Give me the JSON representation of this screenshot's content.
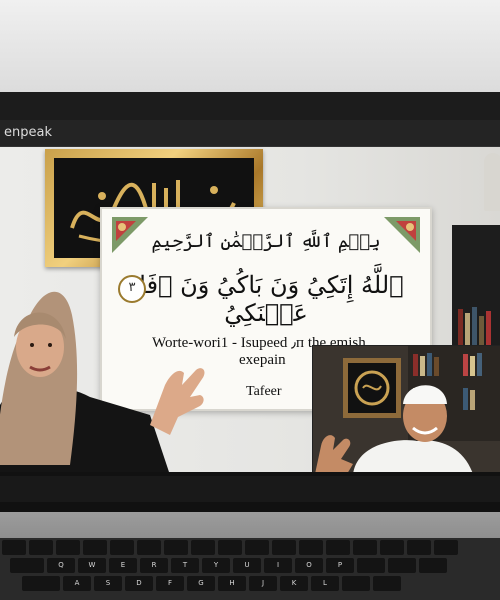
{
  "app": {
    "title": "enpeak"
  },
  "lesson": {
    "basmala": "بِسۡمِ ٱللَّهِ ٱلرَّحۡمَٰنِ ٱلرَّحِيمِ",
    "verse_arabic": "ٱللَّهُ إِتَكِيُ وَنَ بَاكُيُ وَنَ ٱفَلِ عَمۡنَكِيُ",
    "verse_number": "٣",
    "translation_line1": "Worte-wori1 - Isupeed ٫ᴨ the emish",
    "translation_line2": "exepain",
    "caption": "Tafeer"
  },
  "keyboard": {
    "row1": [
      "Q",
      "W",
      "E",
      "R",
      "T",
      "Y",
      "U",
      "I",
      "O",
      "P"
    ],
    "row2": [
      "A",
      "S",
      "D",
      "F",
      "G",
      "H",
      "J",
      "K",
      "L"
    ],
    "row3": [
      "Z",
      "X",
      "C",
      "V",
      "B",
      "N",
      "M"
    ]
  },
  "colors": {
    "accent_gold": "#c9a04a",
    "board_bg": "#fbfaf6",
    "screen_bg": "#1c1c1c"
  }
}
